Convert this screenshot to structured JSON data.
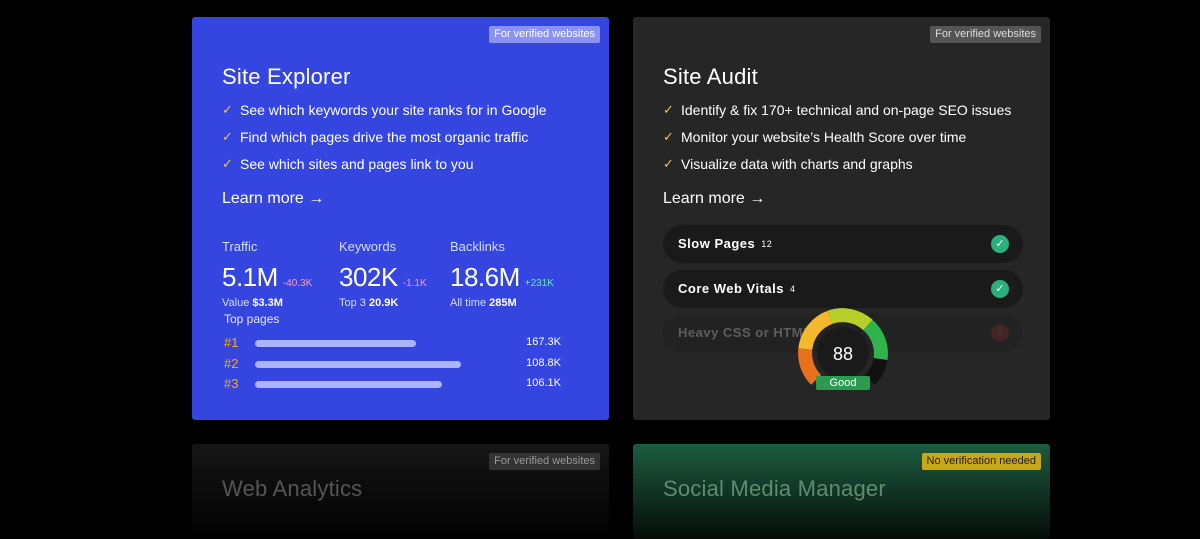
{
  "explorer": {
    "badge": "For verified websites",
    "title": "Site Explorer",
    "features": [
      "See which keywords your site ranks for in Google",
      "Find which pages drive the most organic traffic",
      "See which sites and pages link to you"
    ],
    "learn_more": "Learn more →",
    "metrics": [
      {
        "label": "Traffic",
        "value": "5.1M",
        "delta": "-40.3K",
        "sub_label": "Value",
        "sub_value": "$3.3M"
      },
      {
        "label": "Keywords",
        "value": "302K",
        "delta": "-1.1K",
        "sub_label": "Top 3",
        "sub_value": "20.9K"
      },
      {
        "label": "Backlinks",
        "value": "18.6M",
        "delta": "+231K",
        "sub_label": "All time",
        "sub_value": "285M"
      }
    ],
    "top_pages_label": "Top pages",
    "top_pages": [
      {
        "rank": "#1",
        "value": "167.3K"
      },
      {
        "rank": "#2",
        "value": "108.8K"
      },
      {
        "rank": "#3",
        "value": "106.1K"
      }
    ]
  },
  "audit": {
    "badge": "For verified websites",
    "title": "Site Audit",
    "features": [
      "Identify & fix 170+ technical and on-page SEO issues",
      "Monitor your website’s Health Score over time",
      "Visualize data with charts and graphs"
    ],
    "learn_more": "Learn more →",
    "issues": [
      {
        "label": "Slow Pages",
        "count": "12",
        "status": "✓"
      },
      {
        "label": "Core Web Vitals",
        "count": "4",
        "status": "✓"
      },
      {
        "label": "Heavy CSS or HTML",
        "count": "",
        "status": "!"
      }
    ],
    "health_score": "88",
    "health_label": "Good",
    "gauge_colors": [
      "#e8711c",
      "#f3b92b",
      "#b8cf2a",
      "#2fb34c"
    ]
  },
  "analytics": {
    "badge": "For verified websites",
    "title": "Web Analytics"
  },
  "social": {
    "badge": "No verification needed",
    "title": "Social Media Manager"
  }
}
